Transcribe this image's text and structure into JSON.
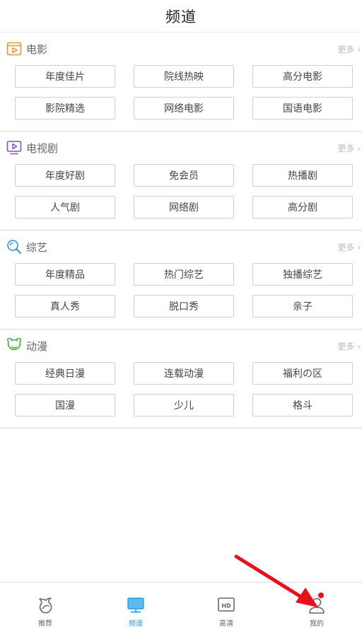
{
  "header": {
    "title": "频道"
  },
  "sections": [
    {
      "title": "电影",
      "more": "更多 ›",
      "icon": "film-icon",
      "color": "#f0922b",
      "tags": [
        "年度佳片",
        "院线热映",
        "高分电影",
        "影院精选",
        "网络电影",
        "国语电影"
      ]
    },
    {
      "title": "电视剧",
      "more": "更多 ›",
      "icon": "tv-icon",
      "color": "#7b4fd9",
      "tags": [
        "年度好剧",
        "免会员",
        "热播剧",
        "人气剧",
        "网络剧",
        "高分剧"
      ]
    },
    {
      "title": "综艺",
      "more": "更多 ›",
      "icon": "variety-icon",
      "color": "#3a8fe0",
      "tags": [
        "年度精品",
        "热门综艺",
        "独播综艺",
        "真人秀",
        "脱口秀",
        "亲子"
      ]
    },
    {
      "title": "动漫",
      "more": "更多 ›",
      "icon": "anime-icon",
      "color": "#38b23c",
      "tags": [
        "经典日漫",
        "连载动漫",
        "福利の区",
        "国漫",
        "少儿",
        "格斗"
      ]
    }
  ],
  "tabbar": [
    {
      "label": "推荐",
      "icon": "recommend-icon",
      "active": false
    },
    {
      "label": "频道",
      "icon": "channel-monitor-icon",
      "active": true
    },
    {
      "label": "高清",
      "icon": "hd-icon",
      "active": false
    },
    {
      "label": "我的",
      "icon": "profile-icon",
      "active": false,
      "badge": true
    }
  ],
  "colors": {
    "accent": "#2f9ae6",
    "badge": "#e8101c",
    "annotation_arrow": "#e8101c"
  }
}
